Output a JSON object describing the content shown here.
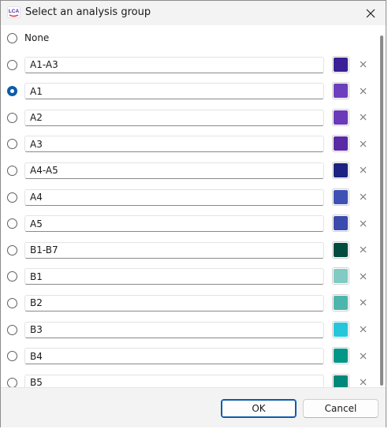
{
  "window": {
    "title": "Select an analysis group",
    "app_icon_text": "LCA"
  },
  "none_option": {
    "label": "None",
    "selected": false
  },
  "groups": [
    {
      "name": "A1-A3",
      "color": "#3a1f96",
      "selected": false
    },
    {
      "name": "A1",
      "color": "#6c3fbf",
      "selected": true
    },
    {
      "name": "A2",
      "color": "#6a3ab9",
      "selected": false
    },
    {
      "name": "A3",
      "color": "#5a2aa6",
      "selected": false
    },
    {
      "name": "A4-A5",
      "color": "#1c2282",
      "selected": false
    },
    {
      "name": "A4",
      "color": "#3f51b5",
      "selected": false
    },
    {
      "name": "A5",
      "color": "#3b4aad",
      "selected": false
    },
    {
      "name": "B1-B7",
      "color": "#004d40",
      "selected": false
    },
    {
      "name": "B1",
      "color": "#80cbc4",
      "selected": false
    },
    {
      "name": "B2",
      "color": "#4db6ac",
      "selected": false
    },
    {
      "name": "B3",
      "color": "#26c6da",
      "selected": false
    },
    {
      "name": "B4",
      "color": "#009688",
      "selected": false
    },
    {
      "name": "B5",
      "color": "#00897b",
      "selected": false
    }
  ],
  "buttons": {
    "ok_label": "OK",
    "cancel_label": "Cancel"
  },
  "icons": {
    "close": "close-icon",
    "remove": "remove-icon",
    "app": "app-logo-icon"
  },
  "colors": {
    "accent": "#0b5cab"
  }
}
